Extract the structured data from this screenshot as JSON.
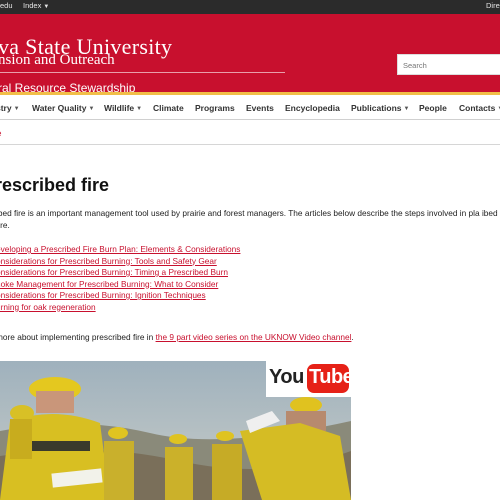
{
  "topbar": {
    "left_items": [
      "edu",
      "Index"
    ],
    "right_item": "Dire"
  },
  "header": {
    "university_line1": "IOWA STATE UNIVERSITY",
    "university_display": "va State University",
    "extension_display": "nsion and Outreach",
    "program_display": "ral Resource Stewardship",
    "search_placeholder": "Search",
    "brand_red": "#c8102e",
    "accent_gold": "#f1be48"
  },
  "nav": {
    "items": [
      {
        "label": "stry",
        "caret": true
      },
      {
        "label": "Water Quality",
        "caret": true
      },
      {
        "label": "Wildlife",
        "caret": true
      },
      {
        "label": "Climate",
        "caret": false
      },
      {
        "label": "Programs",
        "caret": false
      },
      {
        "label": "Events",
        "caret": false
      },
      {
        "label": "Encyclopedia",
        "caret": false
      },
      {
        "label": "Publications",
        "caret": true
      },
      {
        "label": "People",
        "caret": false
      },
      {
        "label": "Contacts",
        "caret": true
      }
    ]
  },
  "breadcrumb": {
    "label": "e"
  },
  "page": {
    "title": "rescribed fire",
    "intro": "ibed fire is an important management tool used by prairie and forest managers. The articles below describe the steps involved in pla ibed fire.",
    "links": [
      "eveloping a Prescribed Fire Burn Plan: Elements & Considerations",
      "onsiderations for Prescribed Burning: Tools and Safety Gear",
      "onsiderations for Prescribed Burning: Timing a Prescribed Burn",
      "noke Management for Prescribed Burning: What to Consider",
      "onsiderations for Prescribed Burning: Ignition Techniques",
      "urning for oak regeneration"
    ],
    "more_prefix": "more about implementing prescribed fire in ",
    "more_link": "the 9 part video series on the UKNOW Video channel",
    "more_suffix": "."
  },
  "video": {
    "logo_you": "You",
    "logo_tube": "Tube"
  }
}
